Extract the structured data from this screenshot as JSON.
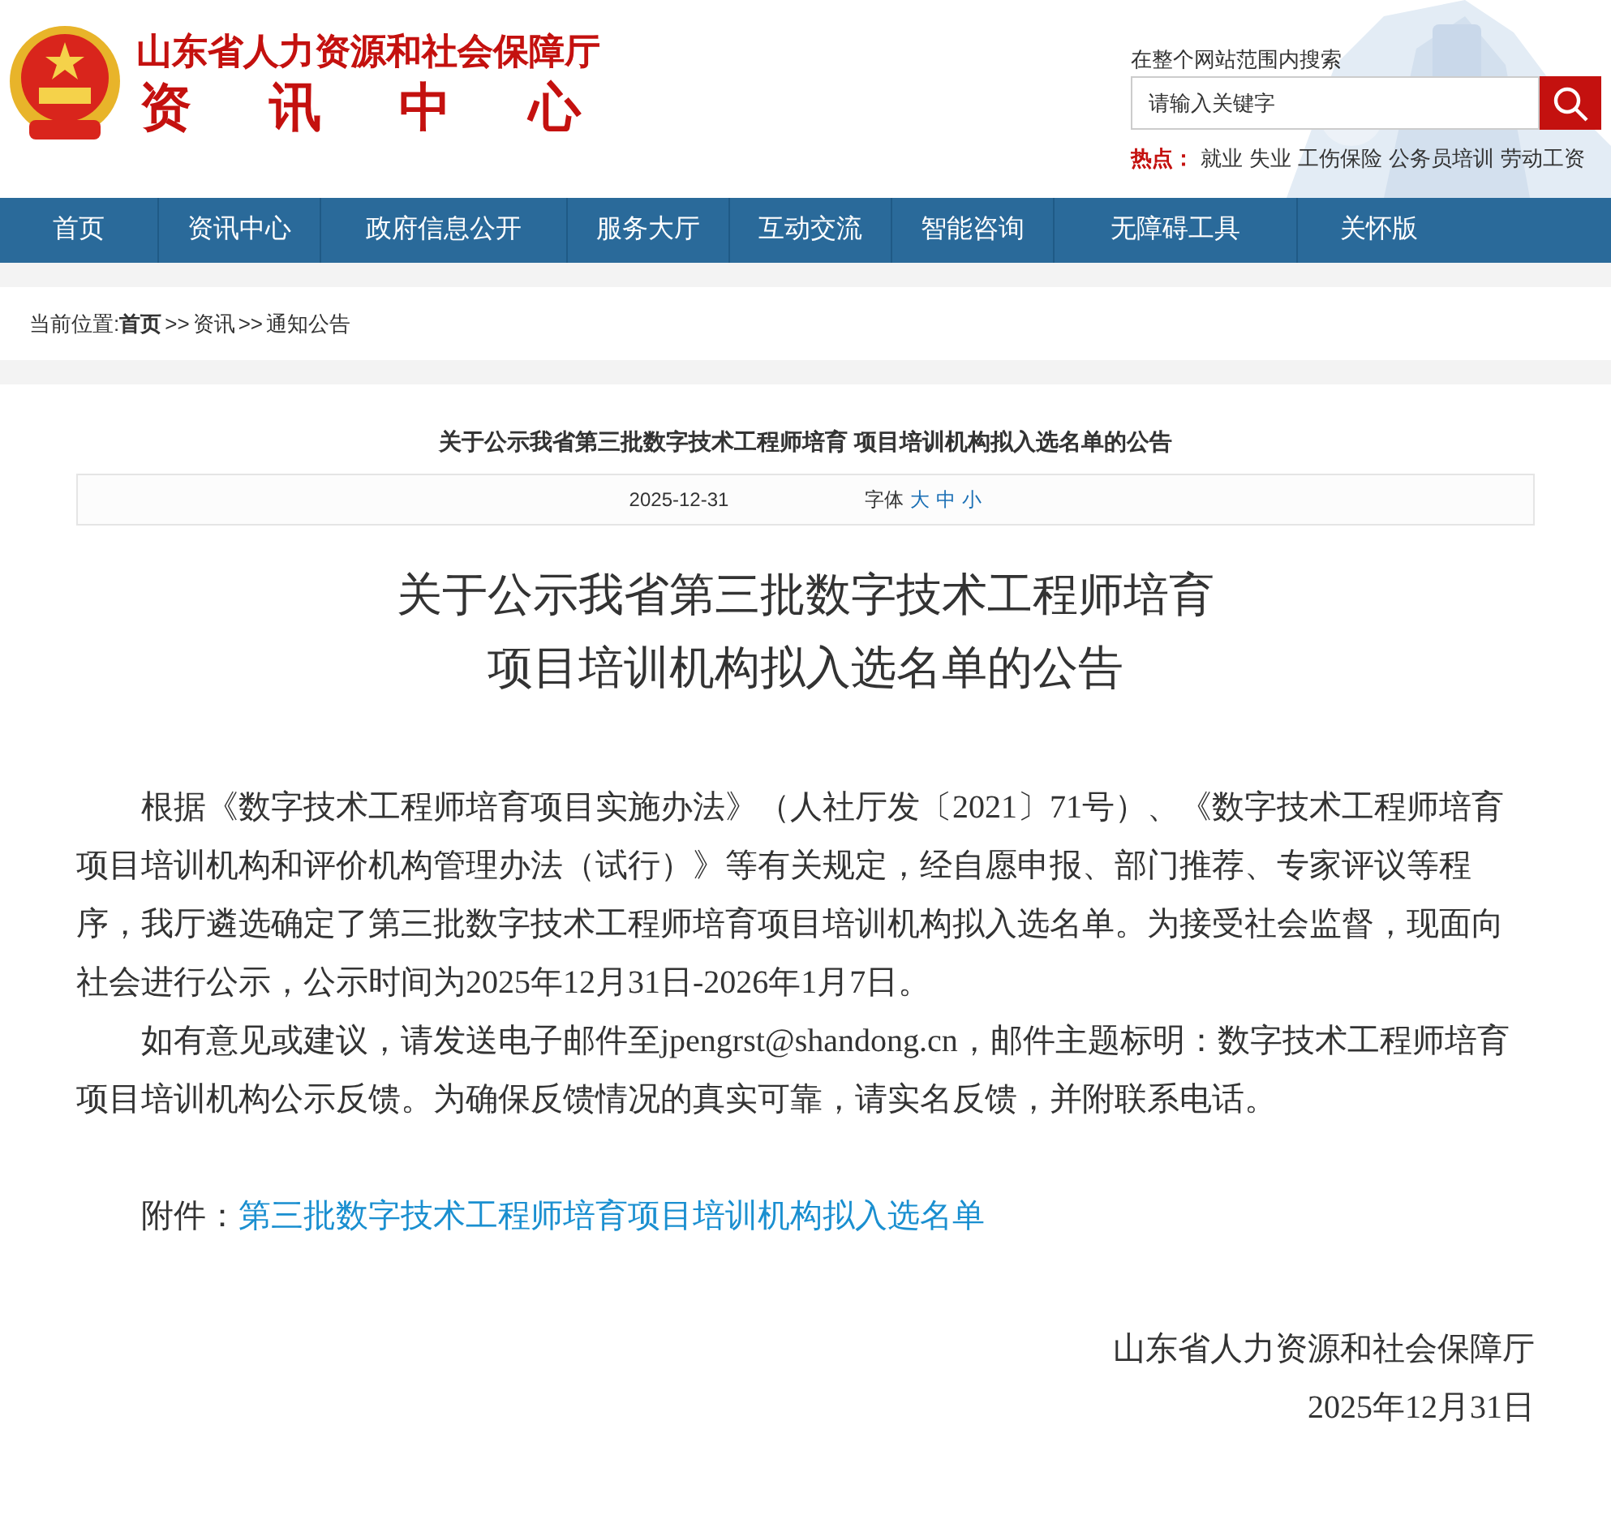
{
  "header": {
    "org_name": "山东省人力资源和社会保障厅",
    "site_name": [
      "资",
      "讯",
      "中",
      "心"
    ],
    "search": {
      "label": "在整个网站范围内搜索",
      "placeholder": "请输入关键字"
    },
    "hot": {
      "label": "热点：",
      "links": [
        "就业",
        "失业",
        "工伤保险",
        "公务员培训",
        "劳动工资"
      ]
    }
  },
  "nav": [
    "首页",
    "资讯中心",
    "政府信息公开",
    "服务大厅",
    "互动交流",
    "智能咨询",
    "无障碍工具",
    "关怀版"
  ],
  "breadcrumb": {
    "label": "当前位置: ",
    "items": [
      {
        "text": "首页",
        "bold": true
      },
      {
        "text": "资讯",
        "bold": false
      },
      {
        "text": "通知公告",
        "bold": false
      }
    ],
    "separator": ">>"
  },
  "article": {
    "header_title": "关于公示我省第三批数字技术工程师培育 项目培训机构拟入选名单的公告",
    "date": "2025-12-31",
    "font_label": "字体",
    "font_sizes": [
      "大",
      "中",
      "小"
    ],
    "title_lines": [
      "关于公示我省第三批数字技术工程师培育",
      "项目培训机构拟入选名单的公告"
    ],
    "paragraphs": [
      "根据《数字技术工程师培育项目实施办法》（人社厅发〔2021〕71号）、《数字技术工程师培育项目培训机构和评价机构管理办法（试行）》等有关规定，经自愿申报、部门推荐、专家评议等程序，我厅遴选确定了第三批数字技术工程师培育项目培训机构拟入选名单。为接受社会监督，现面向社会进行公示，公示时间为2025年12月31日-2026年1月7日。",
      "如有意见或建议，请发送电子邮件至jpengrst@shandong.cn，邮件主题标明：数字技术工程师培育项目培训机构公示反馈。为确保反馈情况的真实可靠，请实名反馈，并附联系电话。"
    ],
    "attachment": {
      "label": "附件：",
      "link": "第三批数字技术工程师培育项目培训机构拟入选名单"
    },
    "signature": "山东省人力资源和社会保障厅",
    "signed_date": "2025年12月31日"
  }
}
